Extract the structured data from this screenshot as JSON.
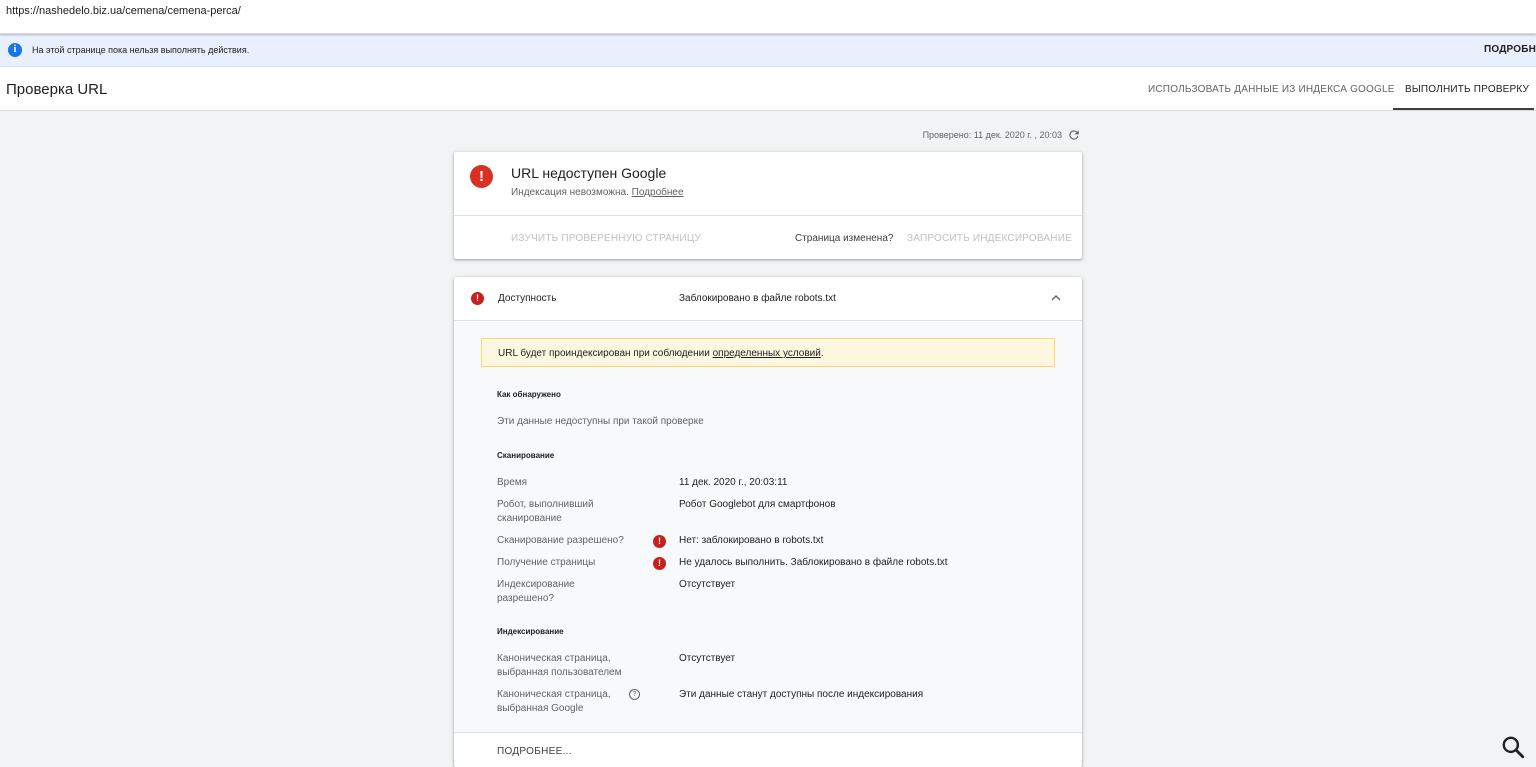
{
  "browser": {
    "url": "https://nashedelo.biz.ua/cemena/cemena-perca/"
  },
  "info_bar": {
    "message": "На этой странице пока нельзя выполнять действия.",
    "more_label": "ПОДРОБНЕ"
  },
  "header": {
    "title": "Проверка URL",
    "tabs": [
      {
        "label": "ИСПОЛЬЗОВАТЬ ДАННЫЕ ИЗ ИНДЕКСА GOOGLE",
        "active": false
      },
      {
        "label": "ВЫПОЛНИТЬ ПРОВЕРКУ",
        "active": true
      }
    ]
  },
  "checked_label": "Проверено: 11 дек. 2020 г. , 20:03",
  "status_card": {
    "title": "URL недоступен Google",
    "subtitle": "Индексация невозможна.",
    "subtitle_link": "Подробнее",
    "inspect_button": "ИЗУЧИТЬ ПРОВЕРЕННУЮ СТРАНИЦУ",
    "page_changed": "Страница изменена?",
    "request_button": "ЗАПРОСИТЬ ИНДЕКСИРОВАНИЕ"
  },
  "coverage": {
    "title": "Доступность",
    "status": "Заблокировано в файле robots.txt",
    "notice_text": "URL будет проиндексирован при соблюдении",
    "notice_link": "определенных условий",
    "notice_end": ".",
    "discovery": {
      "heading": "Как обнаружено",
      "text": "Эти данные недоступны при такой проверке"
    },
    "crawl": {
      "heading": "Сканирование",
      "rows": [
        {
          "label": "Время",
          "value": "11 дек. 2020 г., 20:03:11",
          "error": false
        },
        {
          "label": "Робот, выполнивший сканирование",
          "value": "Робот Googlebot для смартфонов",
          "error": false
        },
        {
          "label": "Сканирование разрешено?",
          "value": "Нет: заблокировано в robots.txt",
          "error": true
        },
        {
          "label": "Получение страницы",
          "value": "Не удалось выполнить. Заблокировано в файле robots.txt",
          "error": true
        },
        {
          "label": "Индексирование разрешено?",
          "value": "Отсутствует",
          "error": false
        }
      ]
    },
    "indexing": {
      "heading": "Индексирование",
      "rows": [
        {
          "label": "Каноническая страница, выбранная пользователем",
          "value": "Отсутствует"
        },
        {
          "label": "Каноническая страница, выбранная Google",
          "value": "Эти данные станут доступны после индексирования",
          "help": "?"
        }
      ]
    },
    "more_button": "ПОДРОБНЕЕ..."
  },
  "icons": {
    "error": "!",
    "info": "i"
  },
  "colors": {
    "error": "#d93025",
    "info": "#1a73e8",
    "notice_bg": "#fef7e0"
  }
}
